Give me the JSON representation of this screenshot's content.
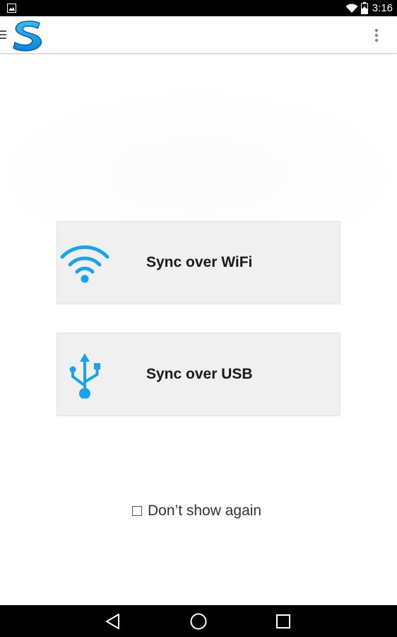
{
  "status_bar": {
    "time": "3:16",
    "icons": [
      "image-notification-icon",
      "wifi-signal-icon",
      "battery-charging-icon"
    ]
  },
  "action_bar": {
    "logo_letter": "S",
    "icons": [
      "drawer-menu-icon",
      "app-logo",
      "overflow-menu-icon"
    ]
  },
  "main": {
    "wifi_button": {
      "label": "Sync over WiFi",
      "icon": "wifi-icon"
    },
    "usb_button": {
      "label": "Sync over USB",
      "icon": "usb-icon"
    },
    "dont_show": {
      "label": "Don’t show again",
      "checked": false
    }
  },
  "nav_bar": {
    "icons": [
      "back-icon",
      "home-icon",
      "recents-icon"
    ]
  },
  "colors": {
    "accent": "#1aa3e8",
    "button_bg": "#f0f0f0",
    "status_bar_bg": "#000000",
    "nav_bar_bg": "#000000"
  }
}
